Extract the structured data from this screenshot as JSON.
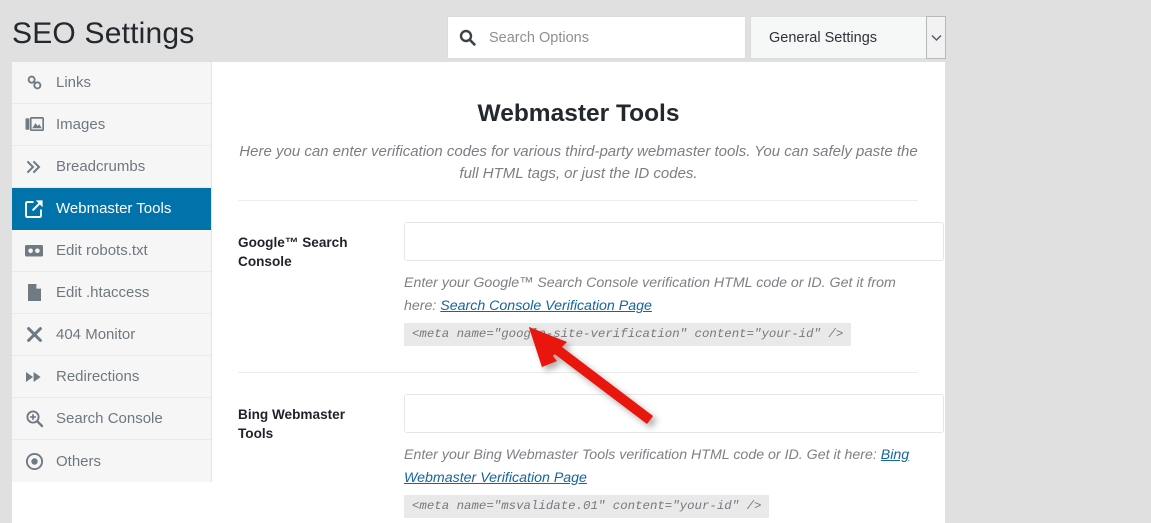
{
  "header": {
    "title": "SEO Settings",
    "search": {
      "icon": "search-icon",
      "placeholder": "Search Options",
      "value": ""
    },
    "settings_select": {
      "selected": "General Settings",
      "arrow_icon": "chevron-down-icon"
    }
  },
  "sidebar": {
    "items": [
      {
        "label": "Links",
        "icon": "link-chain-icon",
        "active": false
      },
      {
        "label": "Images",
        "icon": "images-icon",
        "active": false
      },
      {
        "label": "Breadcrumbs",
        "icon": "double-chevron-right-icon",
        "active": false
      },
      {
        "label": "Webmaster Tools",
        "icon": "external-link-icon",
        "active": true
      },
      {
        "label": "Edit robots.txt",
        "icon": "robot-icon",
        "active": false
      },
      {
        "label": "Edit .htaccess",
        "icon": "file-icon",
        "active": false
      },
      {
        "label": "404 Monitor",
        "icon": "close-x-icon",
        "active": false
      },
      {
        "label": "Redirections",
        "icon": "fast-forward-icon",
        "active": false
      },
      {
        "label": "Search Console",
        "icon": "magnifier-plus-icon",
        "active": false
      },
      {
        "label": "Others",
        "icon": "target-dot-icon",
        "active": false
      }
    ]
  },
  "main": {
    "title": "Webmaster Tools",
    "description": "Here you can enter verification codes for various third-party webmaster tools. You can safely paste the full HTML tags, or just the ID codes.",
    "fields": [
      {
        "label": "Google™ Search Console",
        "value": "",
        "help_before": "Enter your Google™ Search Console verification HTML code or ID. Get it from here: ",
        "help_link": "Search Console Verification Page",
        "help_after": "",
        "code": "<meta name=\"google-site-verification\" content=\"your-id\" />"
      },
      {
        "label": "Bing Webmaster Tools",
        "value": "",
        "help_before": "Enter your Bing Webmaster Tools verification HTML code or ID. Get it here: ",
        "help_link": "Bing Webmaster Verification Page",
        "help_after": "",
        "code": "<meta name=\"msvalidate.01\" content=\"your-id\" />"
      }
    ]
  },
  "annotation": {
    "type": "red-arrow",
    "color": "#e8120c",
    "points_to": "google-search-console-code-snippet"
  },
  "colors": {
    "page_background": "#e0e0e0",
    "panel_background": "#ffffff",
    "sidebar_background": "#f6f6f6",
    "active_accent": "#0273aa",
    "link": "#1565a0",
    "code_background": "#e9e9e9",
    "annotation_red": "#e8120c"
  }
}
